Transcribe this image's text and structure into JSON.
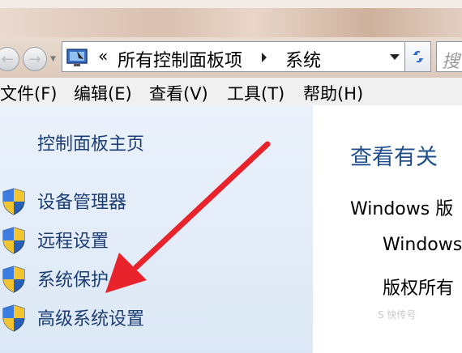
{
  "navigation": {
    "breadcrumb_prefix": "«",
    "breadcrumb": [
      "所有控制面板项",
      "系统"
    ],
    "search_placeholder": "搜"
  },
  "menu": [
    "文件(F)",
    "编辑(E)",
    "查看(V)",
    "工具(T)",
    "帮助(H)"
  ],
  "sidebar": {
    "home": "控制面板主页",
    "tasks": [
      "设备管理器",
      "远程设置",
      "系统保护",
      "高级系统设置"
    ]
  },
  "main": {
    "title": "查看有关",
    "edition_label": "Windows 版",
    "os_name": "Windows",
    "copyright": "版权所有"
  },
  "annotation": {
    "arrow_color": "#e8232b"
  },
  "watermark": "S 快传号"
}
